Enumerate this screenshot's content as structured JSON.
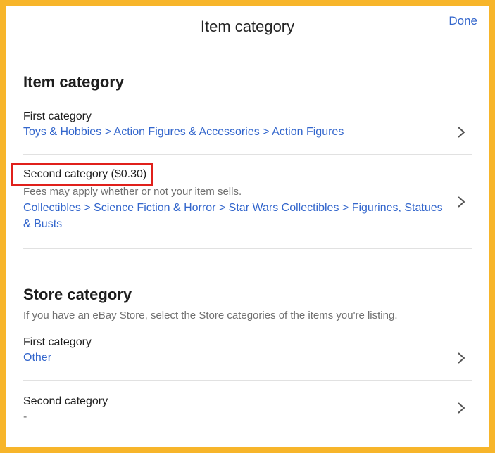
{
  "header": {
    "title": "Item category",
    "done_label": "Done"
  },
  "item_section": {
    "title": "Item category",
    "first": {
      "label": "First category",
      "value": "Toys & Hobbies > Action Figures & Accessories > Action Figures"
    },
    "second": {
      "label": "Second category ($0.30)",
      "note": "Fees may apply whether or not your item sells.",
      "value": "Collectibles > Science Fiction & Horror > Star Wars Collectibles > Figurines, Statues & Busts"
    }
  },
  "store_section": {
    "title": "Store category",
    "subtitle": "If you have an eBay Store, select the Store categories of the items you're listing.",
    "first": {
      "label": "First category",
      "value": "Other"
    },
    "second": {
      "label": "Second category",
      "value": "-"
    }
  },
  "colors": {
    "accent": "#3366cc",
    "border_frame": "#f7b52a",
    "highlight": "#e0201b"
  },
  "icons": {
    "row_chevron": "chevron-right-icon"
  }
}
